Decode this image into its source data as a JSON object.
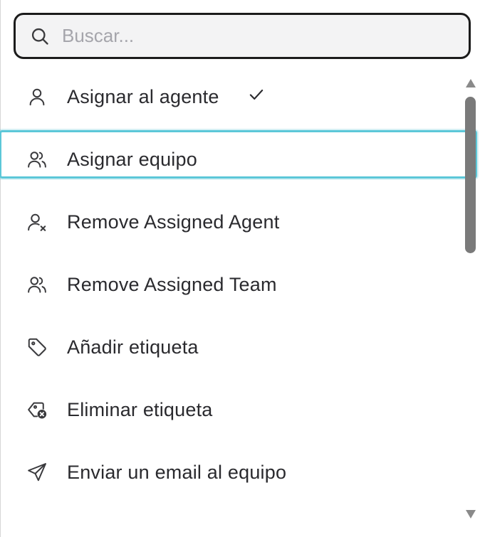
{
  "search": {
    "placeholder": "Buscar...",
    "value": ""
  },
  "menu": {
    "items": [
      {
        "label": "Asignar al agente",
        "icon": "user-icon",
        "checked": true
      },
      {
        "label": "Asignar equipo",
        "icon": "users-icon",
        "focused": true
      },
      {
        "label": "Remove Assigned Agent",
        "icon": "user-remove-icon"
      },
      {
        "label": "Remove Assigned Team",
        "icon": "users-remove-icon"
      },
      {
        "label": "Añadir etiqueta",
        "icon": "tag-icon"
      },
      {
        "label": "Eliminar etiqueta",
        "icon": "tag-remove-icon"
      },
      {
        "label": "Enviar un email al equipo",
        "icon": "send-icon"
      }
    ]
  },
  "colors": {
    "focus_ring": "#5cc7d8",
    "search_border": "#1b1b1b",
    "search_bg": "#f3f3f4",
    "text": "#2a2a2e",
    "scroll_thumb": "#7a7a7a"
  }
}
